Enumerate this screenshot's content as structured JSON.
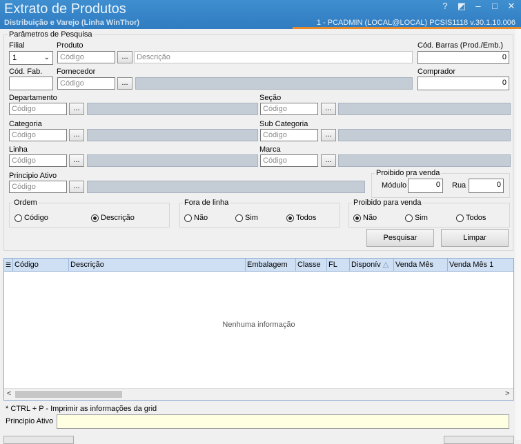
{
  "window": {
    "title": "Extrato de Produtos",
    "subtitle": "Distribuição e Varejo (Linha WinThor)",
    "sysinfo": "1 - PCADMIN (LOCAL@LOCAL)   PCSIS1118  v.30.1.10.006",
    "controls": [
      "?",
      "◩",
      "–",
      "□",
      "✕"
    ]
  },
  "params": {
    "legend": "Parâmetros de Pesquisa",
    "filial_label": "Filial",
    "filial_value": "1",
    "produto_label": "Produto",
    "produto_placeholder": "Código",
    "produto_desc_placeholder": "Descrição",
    "codbarras_label": "Cód. Barras (Prod./Emb.)",
    "codbarras_value": "0",
    "codfab_label": "Cód. Fab.",
    "fornecedor_label": "Fornecedor",
    "fornecedor_placeholder": "Código",
    "comprador_label": "Comprador",
    "comprador_value": "0",
    "departamento_label": "Departamento",
    "departamento_placeholder": "Código",
    "secao_label": "Seção",
    "secao_placeholder": "Código",
    "categoria_label": "Categoria",
    "categoria_placeholder": "Código",
    "subcategoria_label": "Sub Categoria",
    "subcategoria_placeholder": "Código",
    "linha_label": "Linha",
    "linha_placeholder": "Código",
    "marca_label": "Marca",
    "marca_placeholder": "Código",
    "principio_label": "Principio Ativo",
    "principio_placeholder": "Código",
    "dots": "...",
    "proibido_box": {
      "legend": "Proibido pra venda",
      "modulo_label": "Módulo",
      "modulo_value": "0",
      "rua_label": "Rua",
      "rua_value": "0"
    }
  },
  "ordem": {
    "legend": "Ordem",
    "options": [
      "Código",
      "Descrição"
    ],
    "selected": "Descrição"
  },
  "fora_linha": {
    "legend": "Fora de linha",
    "options": [
      "Não",
      "Sim",
      "Todos"
    ],
    "selected": "Todos"
  },
  "proibido_venda": {
    "legend": "Proibido para venda",
    "options": [
      "Não",
      "Sim",
      "Todos"
    ],
    "selected": "Não"
  },
  "buttons": {
    "pesquisar": "Pesquisar",
    "limpar": "Limpar"
  },
  "grid": {
    "columns": [
      "Código",
      "Descrição",
      "Embalagem",
      "Classe",
      "FL",
      "Disponív",
      "Venda Mês",
      "Venda Mês 1"
    ],
    "empty_text": "Nenhuma informação"
  },
  "footer": {
    "hint": "* CTRL + P - Imprimir as informações da grid",
    "principio_label": "Principio Ativo",
    "principio_value": ""
  }
}
